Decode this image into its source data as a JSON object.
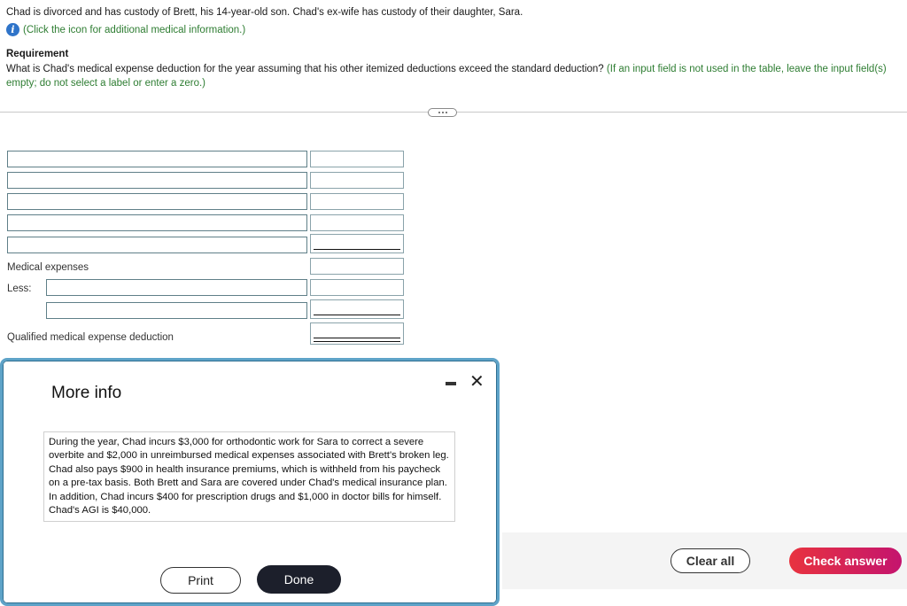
{
  "question": {
    "intro": "Chad is divorced and has custody of Brett, his 14-year-old son. Chad's ex-wife has custody of their daughter, Sara.",
    "info_link": "(Click the icon for additional medical information.)",
    "info_icon": "info-circle-icon"
  },
  "requirement": {
    "title": "Requirement",
    "text": "What is Chad's medical expense deduction for the year assuming that his other itemized deductions exceed the standard deduction?",
    "hint": "(If an input field is not used in the table, leave the input field(s) empty; do not select a label or enter a zero.)"
  },
  "table": {
    "rows": [
      {
        "label": "",
        "amount": ""
      },
      {
        "label": "",
        "amount": ""
      },
      {
        "label": "",
        "amount": ""
      },
      {
        "label": "",
        "amount": ""
      },
      {
        "label": "",
        "amount": ""
      }
    ],
    "medical_expenses_label": "Medical expenses",
    "medical_expenses_amount": "",
    "less_label": "Less:",
    "less_rows": [
      {
        "label": "",
        "amount": ""
      },
      {
        "label": "",
        "amount": ""
      }
    ],
    "deduction_label": "Qualified medical expense deduction",
    "deduction_amount": ""
  },
  "modal": {
    "title": "More info",
    "body": "During the year, Chad incurs $3,000 for orthodontic work for Sara to correct a severe overbite and $2,000 in unreimbursed medical expenses associated with Brett's broken leg. Chad also pays $900 in health insurance premiums, which is withheld from his paycheck on a pre-tax basis. Both Brett and Sara are covered under Chad's medical insurance plan. In addition, Chad incurs $400 for prescription drugs and $1,000 in doctor bills for himself. Chad's AGI is $40,000.",
    "close_glyph": "✕",
    "print_label": "Print",
    "done_label": "Done"
  },
  "footer": {
    "clear_label": "Clear all",
    "check_label": "Check answer"
  }
}
